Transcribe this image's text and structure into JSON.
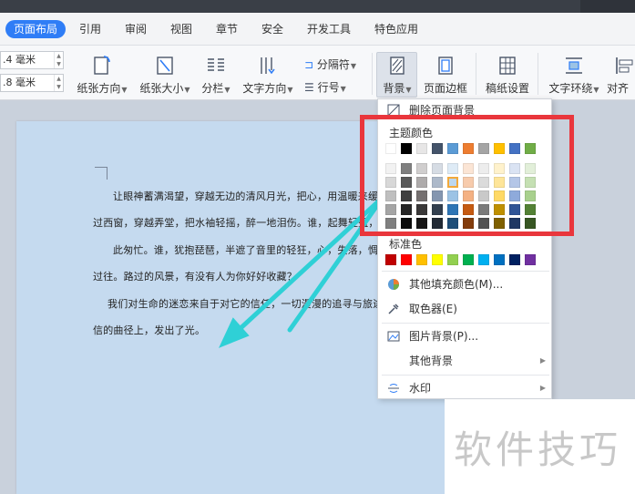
{
  "tabs": [
    {
      "label": "页面布局",
      "active": true
    },
    {
      "label": "引用"
    },
    {
      "label": "审阅"
    },
    {
      "label": "视图"
    },
    {
      "label": "章节"
    },
    {
      "label": "安全"
    },
    {
      "label": "开发工具"
    },
    {
      "label": "特色应用"
    }
  ],
  "ribbon": {
    "margin1": ".4 毫米",
    "margin2": ".8 毫米",
    "orientation": "纸张方向",
    "size": "纸张大小",
    "columns": "分栏",
    "text_direction": "文字方向",
    "separator": "分隔符",
    "line_number": "行号",
    "background": "背景",
    "page_border": "页面边框",
    "draft_settings": "稿纸设置",
    "text_wrap": "文字环绕",
    "align": "对齐"
  },
  "document": {
    "lines": [
      "让眼神蓄满渴望，穿越无边的清风月光，把心，用温暖来缓",
      "过西窗，穿越弄堂，把水袖轻摇，醉一地泪伤。谁，起舞轻盈，诉",
      "此匆忙。谁，犹抱琵琶，半遮了音里的轻狂，心，失落，惆",
      "过往。路过的风景，有没有人为你好好收藏？",
      "我们对生命的迷恋来自于对它的信任，一切漫漫的追寻与旅途",
      "信的曲径上，发出了光。"
    ]
  },
  "menu": {
    "delete_bg": "删除页面背景",
    "theme_colors": "主题颜色",
    "standard_colors": "标准色",
    "more_fill": "其他填充颜色(M)...",
    "eyedropper": "取色器(E)",
    "picture_bg": "图片背景(P)...",
    "other_bg": "其他背景",
    "watermark": "水印"
  },
  "colors": {
    "theme_top": [
      "#ffffff",
      "#000000",
      "#e7e6e6",
      "#44546a",
      "#5b9bd5",
      "#ed7d31",
      "#a5a5a5",
      "#ffc000",
      "#4472c4",
      "#70ad47"
    ],
    "theme_shades": [
      [
        "#f2f2f2",
        "#7f7f7f",
        "#d0cece",
        "#d6dce4",
        "#deebf6",
        "#fbe5d5",
        "#ededed",
        "#fff2cc",
        "#dae3f3",
        "#e2efd9"
      ],
      [
        "#d8d8d8",
        "#595959",
        "#aeabab",
        "#adb9ca",
        "#bdd7ee",
        "#f7cbac",
        "#dbdbdb",
        "#fee599",
        "#b4c6e7",
        "#c5e0b3"
      ],
      [
        "#bfbfbf",
        "#3f3f3f",
        "#757070",
        "#8496b0",
        "#9cc3e5",
        "#f4b183",
        "#c9c9c9",
        "#ffd965",
        "#8eaadb",
        "#a8d08d"
      ],
      [
        "#a5a5a5",
        "#262626",
        "#3a3838",
        "#323f4f",
        "#2e75b5",
        "#c55a11",
        "#7b7b7b",
        "#bf9000",
        "#2f5496",
        "#538135"
      ],
      [
        "#7f7f7f",
        "#0c0c0c",
        "#171616",
        "#222a35",
        "#1e4e79",
        "#833c0b",
        "#525252",
        "#7f6000",
        "#1f3864",
        "#375623"
      ]
    ],
    "standard": [
      "#c00000",
      "#ff0000",
      "#ffc000",
      "#ffff00",
      "#92d050",
      "#00b050",
      "#00b0f0",
      "#0070c0",
      "#002060",
      "#7030a0"
    ]
  },
  "watermark_text": "软件技巧"
}
